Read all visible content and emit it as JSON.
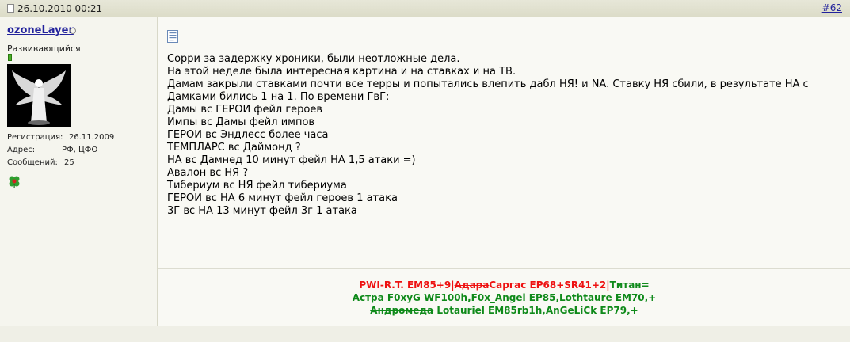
{
  "post": {
    "date": "26.10.2010 00:21",
    "number": "#62"
  },
  "user": {
    "name": "ozoneLayer",
    "title": "Развивающийся",
    "status": "offline",
    "info": [
      {
        "label": "Регистрация:",
        "value": "26.11.2009"
      },
      {
        "label": "Адрес:",
        "value": "РФ, ЦФО"
      },
      {
        "label": "Сообщений:",
        "value": "25"
      }
    ]
  },
  "message": {
    "lines": [
      "Сорри за задержку хроники, были неотложные дела.",
      "На этой неделе была интересная картина и на ставках и на ТВ.",
      "Дамам закрыли ставками почти все терры и попытались влепить дабл НЯ! и NA. Ставку НЯ сбили, в результате НА с",
      "Дамками бились 1 на 1. По времени ГвГ:",
      "Дамы вс ГЕРОИ фейл героев",
      "Импы вс Дамы фейл импов",
      "ГЕРОИ вс Эндлесс более часа",
      "ТЕМПЛАРС вс Даймонд ?",
      "НА вс Дамнед 10 минут фейл НА 1,5 атаки =)",
      "Авалон вс НЯ ?",
      "Тибериум вс НЯ фейл тибериума",
      "ГЕРОИ вс НА 6 минут фейл героев 1 атака",
      "3Г вс НА 13 минут фейл 3г 1 атака"
    ]
  },
  "signature": {
    "line1": [
      {
        "text": "PWI-R.T. EM85+9|",
        "color": "red",
        "strike": false
      },
      {
        "text": "Адара",
        "color": "red",
        "strike": true
      },
      {
        "text": "Саргас EP68+SR41+2|",
        "color": "red",
        "strike": false
      },
      {
        "text": "Титан=",
        "color": "green",
        "strike": false
      }
    ],
    "line2": [
      {
        "text": "Астра",
        "color": "green",
        "strike": true
      },
      {
        "text": " F0xyG WF100h,F0x_Angel EP85,Lothtaure EM70,+",
        "color": "green",
        "strike": false
      }
    ],
    "line3": [
      {
        "text": "Андромеда",
        "color": "green",
        "strike": true
      },
      {
        "text": " Lotauriel EM85rb1h,AnGeLiCk EP79,+",
        "color": "green",
        "strike": false
      }
    ]
  },
  "colors": {
    "link": "#22229c",
    "sig_red": "#ee1111",
    "sig_green": "#0f8a1a",
    "background": "#f5f5ee"
  },
  "icons": {
    "post_icon": "document-icon",
    "message_icon": "message-doc-icon",
    "reputation": "clover-icon",
    "status": "offline-status-icon"
  }
}
